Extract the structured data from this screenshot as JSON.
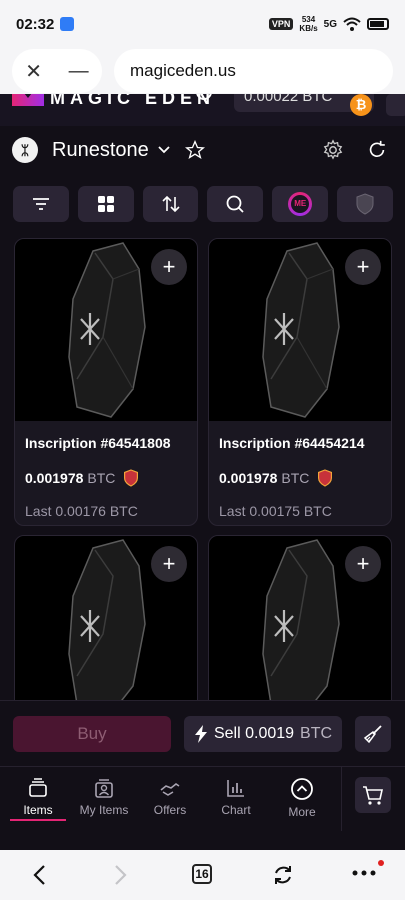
{
  "status": {
    "time": "02:32",
    "vpn": "VPN",
    "net_speed": "534",
    "net_unit": "KB/s",
    "signal": "5G"
  },
  "browser": {
    "url": "magiceden.us",
    "tab_count": "16"
  },
  "site": {
    "logo_text": "MAGIC EDEN",
    "wallet_balance": "0.00022 BTC",
    "coin_symbol": "₿"
  },
  "collection": {
    "avatar_glyph": "ᛯ",
    "name": "Runestone"
  },
  "cards": [
    {
      "title": "Inscription #64541808",
      "price": "0.001978",
      "unit": "BTC",
      "last": "Last 0.00176 BTC"
    },
    {
      "title": "Inscription #64454214",
      "price": "0.001978",
      "unit": "BTC",
      "last": "Last 0.00175 BTC"
    },
    {
      "title": "",
      "price": "",
      "unit": "",
      "last": ""
    },
    {
      "title": "",
      "price": "",
      "unit": "",
      "last": ""
    }
  ],
  "actions": {
    "buy_label": "Buy",
    "sell_label": "Sell 0.0019",
    "sell_unit": "BTC"
  },
  "tabs": [
    {
      "label": "Items",
      "icon": "items-icon",
      "active": true
    },
    {
      "label": "My Items",
      "icon": "my-items-icon"
    },
    {
      "label": "Offers",
      "icon": "offers-icon"
    },
    {
      "label": "Chart",
      "icon": "chart-icon"
    },
    {
      "label": "More",
      "icon": "more-icon"
    }
  ],
  "colors": {
    "accent": "#e42575",
    "background": "#120f17",
    "panel": "#2b2535",
    "buy_bg": "#4a1530"
  }
}
